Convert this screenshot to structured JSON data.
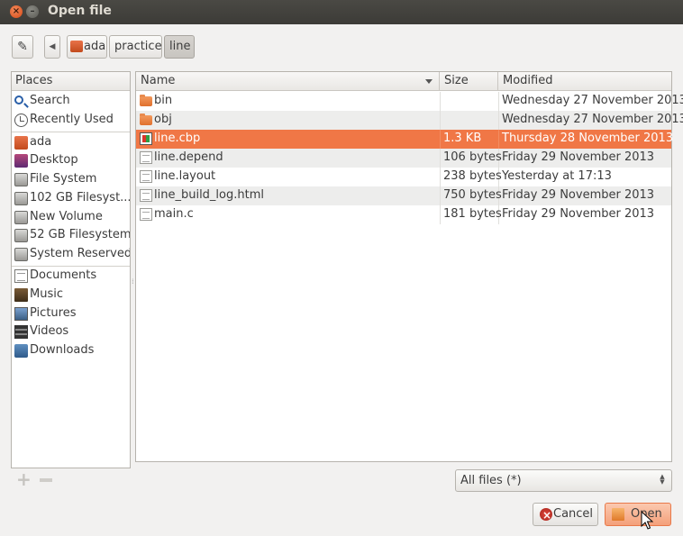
{
  "window": {
    "title": "Open file",
    "close_glyph": "×",
    "minimize_glyph": "–"
  },
  "location": {
    "edit_glyph": "✎",
    "back_glyph": "◀",
    "breadcrumbs": [
      "ada",
      "practice",
      "line"
    ]
  },
  "places": {
    "header": "Places",
    "items": [
      {
        "label": "Search",
        "icon": "search-icon"
      },
      {
        "label": "Recently Used",
        "icon": "recent-icon"
      },
      {
        "label": "ada",
        "icon": "home-icon"
      },
      {
        "label": "Desktop",
        "icon": "desktop-icon"
      },
      {
        "label": "File System",
        "icon": "drive-icon"
      },
      {
        "label": "102 GB Filesyst...",
        "icon": "drive-icon"
      },
      {
        "label": "New Volume",
        "icon": "drive-icon"
      },
      {
        "label": "52 GB Filesystem",
        "icon": "drive-icon"
      },
      {
        "label": "System Reserved",
        "icon": "drive-icon"
      },
      {
        "label": "Documents",
        "icon": "documents-icon"
      },
      {
        "label": "Music",
        "icon": "music-icon"
      },
      {
        "label": "Pictures",
        "icon": "pictures-icon"
      },
      {
        "label": "Videos",
        "icon": "videos-icon"
      },
      {
        "label": "Downloads",
        "icon": "downloads-icon"
      }
    ],
    "add_glyph": "+"
  },
  "files": {
    "columns": {
      "name": "Name",
      "size": "Size",
      "modified": "Modified"
    },
    "rows": [
      {
        "name": "bin",
        "size": "",
        "modified": "Wednesday 27 November 2013",
        "icon": "folder-icon"
      },
      {
        "name": "obj",
        "size": "",
        "modified": "Wednesday 27 November 2013",
        "icon": "folder-icon"
      },
      {
        "name": "line.cbp",
        "size": "1.3 KB",
        "modified": "Thursday 28 November 2013",
        "icon": "cbp-file-icon",
        "selected": true
      },
      {
        "name": "line.depend",
        "size": "106 bytes",
        "modified": "Friday 29 November 2013",
        "icon": "text-file-icon"
      },
      {
        "name": "line.layout",
        "size": "238 bytes",
        "modified": "Yesterday at 17:13",
        "icon": "text-file-icon"
      },
      {
        "name": "line_build_log.html",
        "size": "750 bytes",
        "modified": "Friday 29 November 2013",
        "icon": "text-file-icon"
      },
      {
        "name": "main.c",
        "size": "181 bytes",
        "modified": "Friday 29 November 2013",
        "icon": "text-file-icon"
      }
    ]
  },
  "filter": {
    "selected": "All files (*)",
    "updown_glyph": "▲▼"
  },
  "buttons": {
    "cancel": "Cancel",
    "open": "Open"
  },
  "colors": {
    "selection": "#f07746",
    "titlebar": "#3c3b37",
    "accent": "#e8794a"
  }
}
